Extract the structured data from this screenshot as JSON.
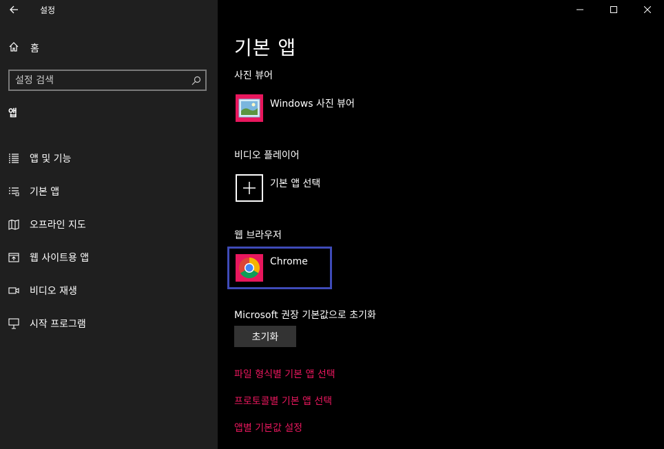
{
  "window": {
    "title": "설정"
  },
  "sidebar": {
    "home_label": "홈",
    "search_placeholder": "설정 검색",
    "section_label": "앱",
    "items": [
      {
        "label": "앱 및 기능",
        "icon": "apps-features-icon"
      },
      {
        "label": "기본 앱",
        "icon": "default-apps-icon"
      },
      {
        "label": "오프라인 지도",
        "icon": "offline-maps-icon"
      },
      {
        "label": "웹 사이트용 앱",
        "icon": "apps-for-websites-icon"
      },
      {
        "label": "비디오 재생",
        "icon": "video-playback-icon"
      },
      {
        "label": "시작 프로그램",
        "icon": "startup-icon"
      }
    ]
  },
  "main": {
    "title": "기본 앱",
    "photo_viewer": {
      "category": "사진 뷰어",
      "app": "Windows 사진 뷰어"
    },
    "video_player": {
      "category": "비디오 플레이어",
      "app": "기본 앱 선택"
    },
    "web_browser": {
      "category": "웹 브라우저",
      "app": "Chrome"
    },
    "reset": {
      "label": "Microsoft 권장 기본값으로 초기화",
      "button": "초기화"
    },
    "links": [
      "파일 형식별 기본 앱 선택",
      "프로토콜별 기본 앱 선택",
      "앱별 기본값 설정"
    ]
  },
  "colors": {
    "accent": "#e8175d",
    "focus": "#3f4bb9",
    "sidebar_bg": "#1f1f1f",
    "main_bg": "#000000"
  }
}
